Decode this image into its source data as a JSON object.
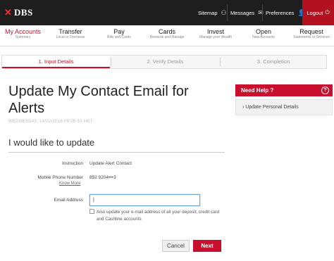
{
  "brand": {
    "name": "DBS",
    "logo_mark": "✕"
  },
  "topbar": {
    "sitemap": "Sitemap",
    "sitemap_icon": "⚇",
    "messages": "Messages",
    "messages_icon": "✉",
    "preferences": "Preferences",
    "preferences_icon": "👤",
    "logout": "Logout",
    "logout_icon": "⏻"
  },
  "mainnav": [
    {
      "title": "My Accounts",
      "sub": "Summary"
    },
    {
      "title": "Transfer",
      "sub": "Local or Overseas"
    },
    {
      "title": "Pay",
      "sub": "Bills and Cards"
    },
    {
      "title": "Cards",
      "sub": "Rewards and Manage"
    },
    {
      "title": "Invest",
      "sub": "Manage your Wealth"
    },
    {
      "title": "Open",
      "sub": "New Accounts"
    },
    {
      "title": "Request",
      "sub": "Statements or Services"
    }
  ],
  "steps": [
    "1. Input Details",
    "2. Verify Details",
    "3. Completion"
  ],
  "page": {
    "title": "Update My Contact Email for Alerts",
    "date": "WEDNESDAY, 14/02/2018 09:05:53 HKT",
    "subtitle": "I would like to update"
  },
  "form": {
    "instruction_label": "Instruction",
    "instruction_value": "Update Alert Contact",
    "mobile_label": "Mobile Phone Number",
    "mobile_value": "852 9204•••3",
    "know_more": "Know More",
    "email_label": "Email Address",
    "email_value": "|",
    "checkbox_label": "Also update your e-mail address of all your deposit, credit card and Cashline accounts"
  },
  "buttons": {
    "cancel": "Cancel",
    "next": "Next"
  },
  "help": {
    "title": "Need Help ?",
    "icon": "?",
    "item": "Update Personal Details",
    "item_icon": "›"
  },
  "colors": {
    "accent": "#c8102e",
    "topbar": "#1e1e1e"
  }
}
